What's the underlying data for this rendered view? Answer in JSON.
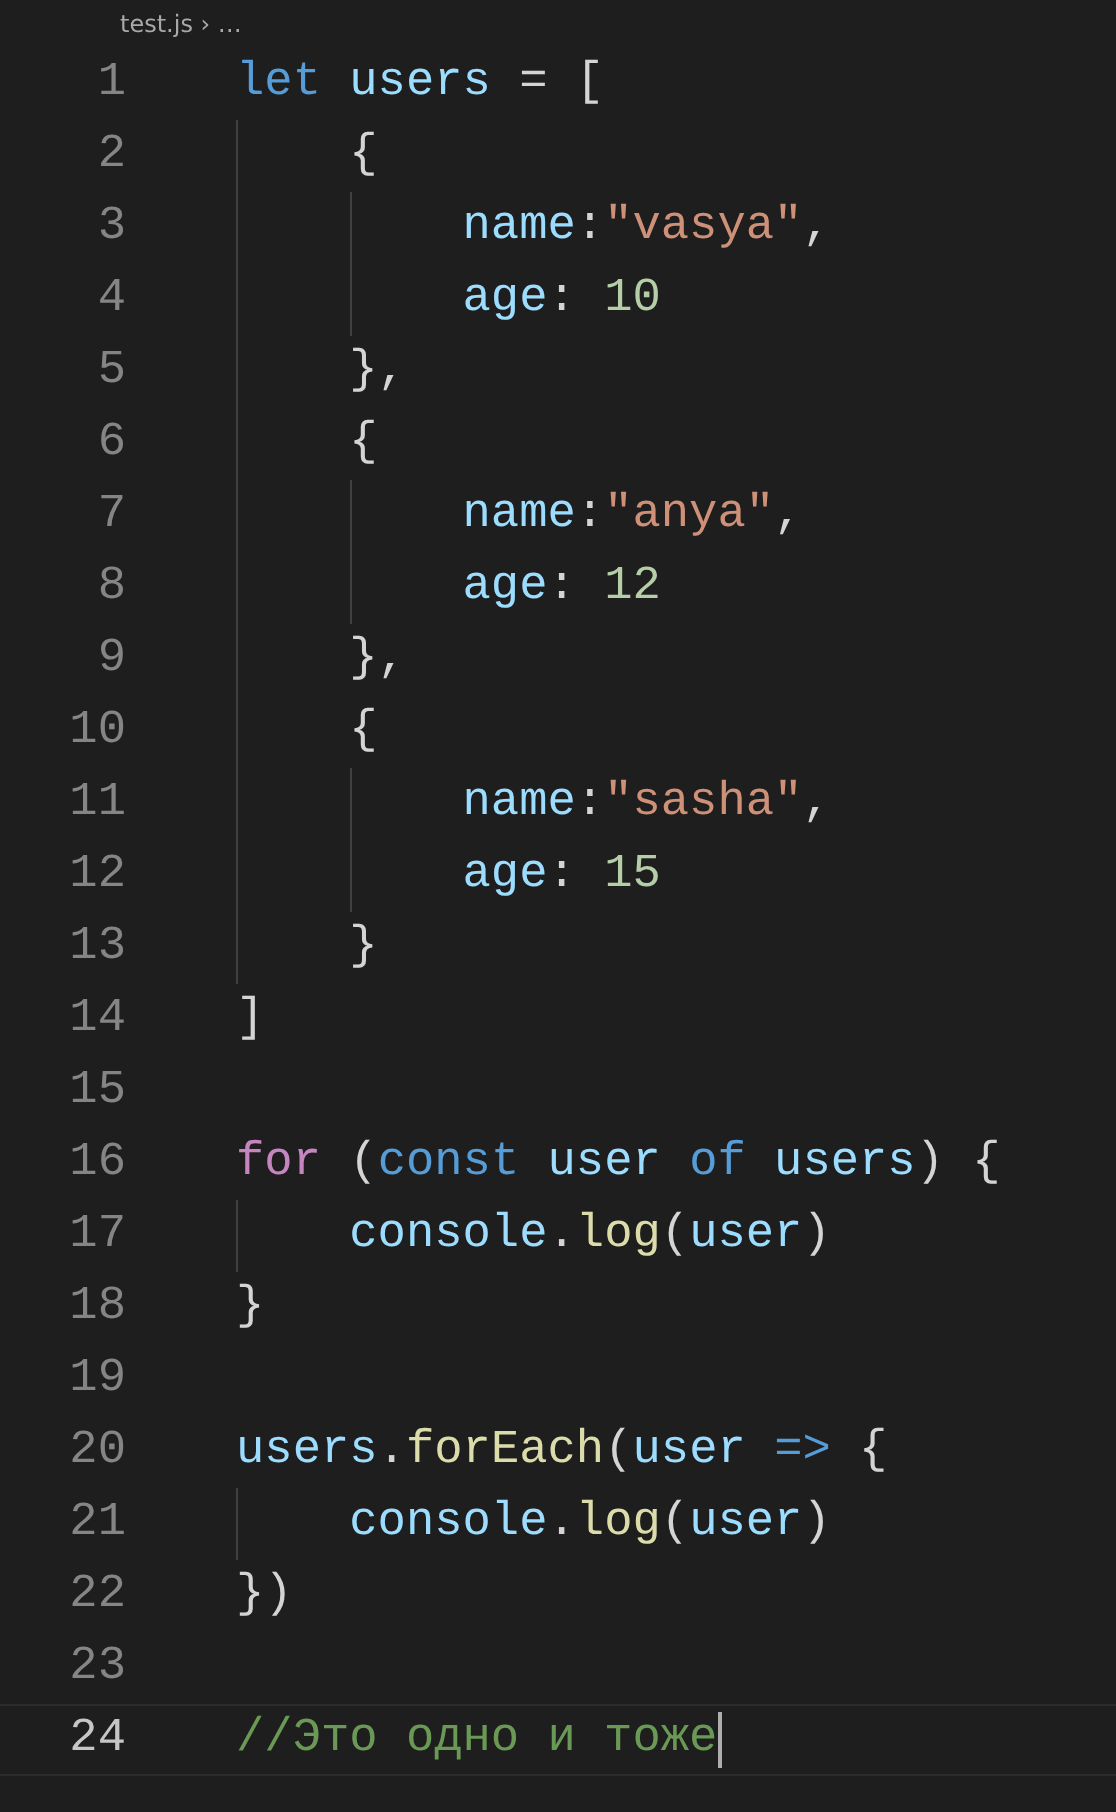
{
  "breadcrumb": "test.js › …",
  "lines": [
    {
      "number": "1",
      "current": false,
      "tokens": [
        {
          "kind": "keyword",
          "text": "let"
        },
        {
          "kind": "variable",
          "text": " users"
        },
        {
          "kind": "plain",
          "text": " = ["
        }
      ]
    },
    {
      "number": "2",
      "current": false,
      "tokens": [
        {
          "kind": "plain",
          "text": "    {"
        }
      ]
    },
    {
      "number": "3",
      "current": false,
      "tokens": [
        {
          "kind": "variable",
          "text": "        name"
        },
        {
          "kind": "plain",
          "text": ":"
        },
        {
          "kind": "string",
          "text": "\"vasya\""
        },
        {
          "kind": "plain",
          "text": ","
        }
      ]
    },
    {
      "number": "4",
      "current": false,
      "tokens": [
        {
          "kind": "variable",
          "text": "        age"
        },
        {
          "kind": "plain",
          "text": ":"
        },
        {
          "kind": "number",
          "text": " 10"
        }
      ]
    },
    {
      "number": "5",
      "current": false,
      "tokens": [
        {
          "kind": "plain",
          "text": "    },"
        }
      ]
    },
    {
      "number": "6",
      "current": false,
      "tokens": [
        {
          "kind": "plain",
          "text": "    {"
        }
      ]
    },
    {
      "number": "7",
      "current": false,
      "tokens": [
        {
          "kind": "variable",
          "text": "        name"
        },
        {
          "kind": "plain",
          "text": ":"
        },
        {
          "kind": "string",
          "text": "\"anya\""
        },
        {
          "kind": "plain",
          "text": ","
        }
      ]
    },
    {
      "number": "8",
      "current": false,
      "tokens": [
        {
          "kind": "variable",
          "text": "        age"
        },
        {
          "kind": "plain",
          "text": ":"
        },
        {
          "kind": "number",
          "text": " 12"
        }
      ]
    },
    {
      "number": "9",
      "current": false,
      "tokens": [
        {
          "kind": "plain",
          "text": "    },"
        }
      ]
    },
    {
      "number": "10",
      "current": false,
      "tokens": [
        {
          "kind": "plain",
          "text": "    {"
        }
      ]
    },
    {
      "number": "11",
      "current": false,
      "tokens": [
        {
          "kind": "variable",
          "text": "        name"
        },
        {
          "kind": "plain",
          "text": ":"
        },
        {
          "kind": "string",
          "text": "\"sasha\""
        },
        {
          "kind": "plain",
          "text": ","
        }
      ]
    },
    {
      "number": "12",
      "current": false,
      "tokens": [
        {
          "kind": "variable",
          "text": "        age"
        },
        {
          "kind": "plain",
          "text": ":"
        },
        {
          "kind": "number",
          "text": " 15"
        }
      ]
    },
    {
      "number": "13",
      "current": false,
      "tokens": [
        {
          "kind": "plain",
          "text": "    }"
        }
      ]
    },
    {
      "number": "14",
      "current": false,
      "tokens": [
        {
          "kind": "plain",
          "text": "]"
        }
      ]
    },
    {
      "number": "15",
      "current": false
    },
    {
      "number": "16",
      "current": false,
      "tokens": [
        {
          "kind": "control",
          "text": "for"
        },
        {
          "kind": "plain",
          "text": " ("
        },
        {
          "kind": "keyword",
          "text": "const"
        },
        {
          "kind": "variable",
          "text": " user"
        },
        {
          "kind": "keyword",
          "text": " of"
        },
        {
          "kind": "variable",
          "text": " users"
        },
        {
          "kind": "plain",
          "text": ") {"
        }
      ]
    },
    {
      "number": "17",
      "current": false,
      "tokens": [
        {
          "kind": "variable",
          "text": "    console"
        },
        {
          "kind": "plain",
          "text": "."
        },
        {
          "kind": "function",
          "text": "log"
        },
        {
          "kind": "plain",
          "text": "("
        },
        {
          "kind": "variable",
          "text": "user"
        },
        {
          "kind": "plain",
          "text": ")"
        }
      ]
    },
    {
      "number": "18",
      "current": false,
      "tokens": [
        {
          "kind": "plain",
          "text": "}"
        }
      ]
    },
    {
      "number": "19",
      "current": false
    },
    {
      "number": "20",
      "current": false,
      "tokens": [
        {
          "kind": "variable",
          "text": "users"
        },
        {
          "kind": "plain",
          "text": "."
        },
        {
          "kind": "function",
          "text": "forEach"
        },
        {
          "kind": "plain",
          "text": "("
        },
        {
          "kind": "variable",
          "text": "user"
        },
        {
          "kind": "keyword",
          "text": " =>"
        },
        {
          "kind": "plain",
          "text": " {"
        }
      ]
    },
    {
      "number": "21",
      "current": false,
      "tokens": [
        {
          "kind": "variable",
          "text": "    console"
        },
        {
          "kind": "plain",
          "text": "."
        },
        {
          "kind": "function",
          "text": "log"
        },
        {
          "kind": "plain",
          "text": "("
        },
        {
          "kind": "variable",
          "text": "user"
        },
        {
          "kind": "plain",
          "text": ")"
        }
      ]
    },
    {
      "number": "22",
      "current": false,
      "tokens": [
        {
          "kind": "plain",
          "text": "})"
        }
      ]
    },
    {
      "number": "23",
      "current": false
    },
    {
      "number": "24",
      "current": true,
      "tokens": [
        {
          "kind": "comment",
          "text": "//Это одно и тоже"
        }
      ]
    }
  ]
}
